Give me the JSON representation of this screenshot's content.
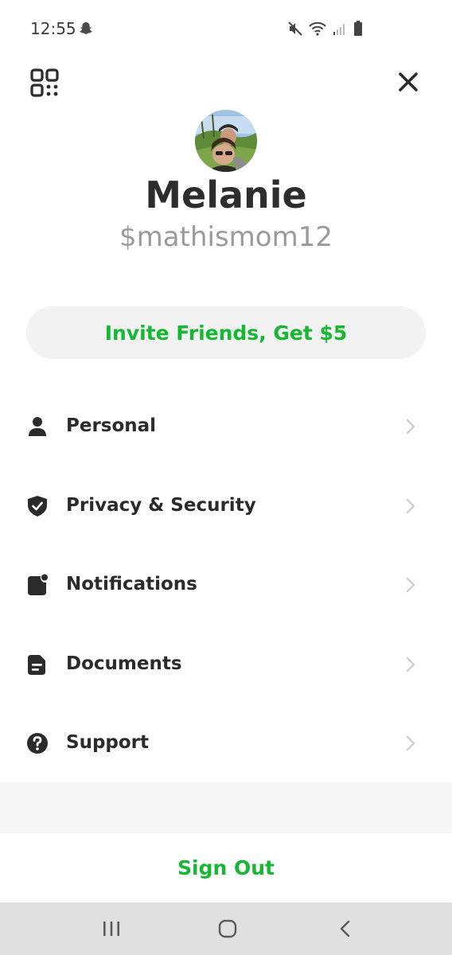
{
  "status_bar": {
    "time": "12:55",
    "icons": [
      "snapchat-icon",
      "mute-icon",
      "wifi-icon",
      "signal-icon",
      "battery-icon"
    ]
  },
  "header": {
    "qr_icon": "qr-code-icon",
    "close_icon": "close-icon"
  },
  "profile": {
    "name": "Melanie",
    "cashtag": "$mathismom12"
  },
  "invite": {
    "label": "Invite Friends, Get $5"
  },
  "menu": {
    "items": [
      {
        "label": "Personal",
        "icon": "person-icon"
      },
      {
        "label": "Privacy & Security",
        "icon": "shield-icon"
      },
      {
        "label": "Notifications",
        "icon": "notification-icon"
      },
      {
        "label": "Documents",
        "icon": "document-icon"
      },
      {
        "label": "Support",
        "icon": "help-icon"
      }
    ]
  },
  "footer": {
    "sign_out_label": "Sign Out"
  },
  "nav_bar": {
    "buttons": [
      "recents-icon",
      "home-icon",
      "back-icon"
    ]
  },
  "colors": {
    "accent": "#16b733",
    "text": "#2b2b2b",
    "muted": "#9a9a9a",
    "pill_bg": "#f2f2f2",
    "nav_bg": "#e0e0e0"
  }
}
